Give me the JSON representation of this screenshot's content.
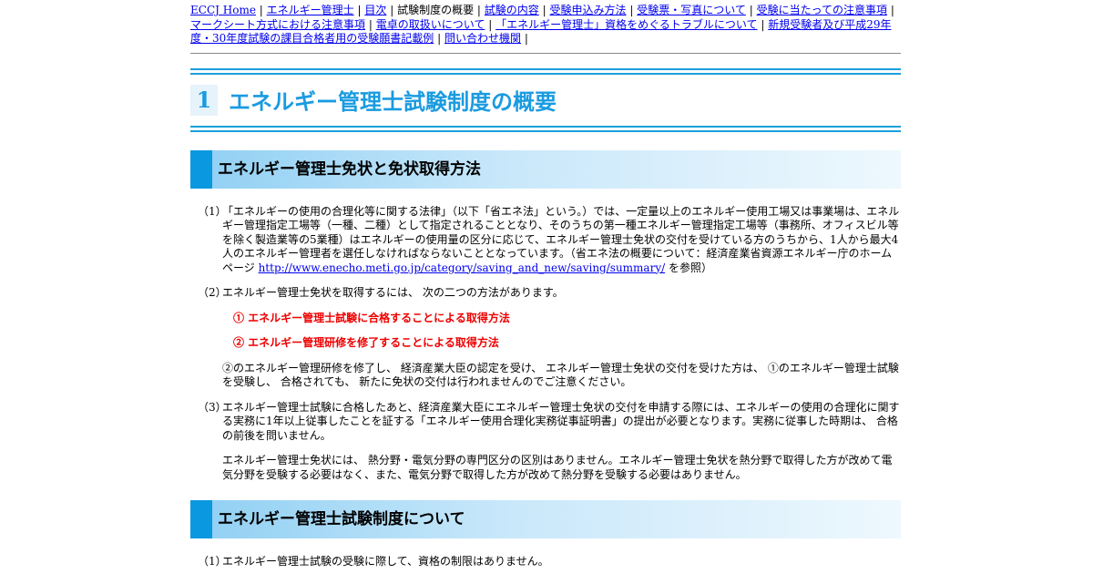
{
  "nav": {
    "items": [
      {
        "label": "ECCJ Home",
        "link": true
      },
      {
        "label": "エネルギー管理士",
        "link": true
      },
      {
        "label": "目次",
        "link": true
      },
      {
        "label": "試験制度の概要",
        "link": false
      },
      {
        "label": "試験の内容",
        "link": true
      },
      {
        "label": "受験申込み方法",
        "link": true
      },
      {
        "label": "受験票・写真について",
        "link": true
      },
      {
        "label": "受験に当たっての注意事項",
        "link": true
      },
      {
        "label": "マークシート方式における注意事項",
        "link": true
      },
      {
        "label": "電卓の取扱いについて",
        "link": true
      },
      {
        "label": "「エネルギー管理士」資格をめぐるトラブルについて",
        "link": true
      },
      {
        "label": "新規受験者及び平成29年度・30年度試験の課目合格者用の受験願書記載例",
        "link": true
      },
      {
        "label": "問い合わせ機関",
        "link": true
      }
    ],
    "separator": "|"
  },
  "main": {
    "section_number": "1",
    "title": "エネルギー管理士試験制度の概要",
    "sections": [
      {
        "heading": "エネルギー管理士免状と免状取得方法",
        "p1_num": "（1）",
        "p1_text": "「エネルギーの使用の合理化等に関する法律」（以下「省エネ法」という。）では、一定量以上のエネルギー使用工場又は事業場は、エネルギー管理指定工場等（一種、二種）として指定されることとなり、そのうちの第一種エネルギー管理指定工場等（事務所、オフィスビル等を除く製造業等の5業種）はエネルギーの使用量の区分に応じて、エネルギー管理士免状の交付を受けている方のうちから、1人から最大4人のエネルギー管理者を選任しなければならないこととなっています。（省エネ法の概要について：経済産業省資源エネルギー庁のホームページ ",
        "p1_link": "http://www.enecho.meti.go.jp/category/saving_and_new/saving/summary/",
        "p1_after": " を参照）",
        "p2_num": "（2）",
        "p2_text": "エネルギー管理士免状を取得するには、 次の二つの方法があります。",
        "method1": "① エネルギー管理士試験に合格することによる取得方法",
        "method2": "② エネルギー管理研修を修了することによる取得方法",
        "note": "②のエネルギー管理研修を修了し、 経済産業大臣の認定を受け、 エネルギー管理士免状の交付を受けた方は、 ①のエネルギー管理士試験を受験し、 合格されても、 新たに免状の交付は行われませんのでご注意ください。",
        "p3_num": "（3）",
        "p3_text": "エネルギー管理士試験に合格したあと、経済産業大臣にエネルギー管理士免状の交付を申請する際には、エネルギーの使用の合理化に関する実務に1年以上従事したことを証する「エネルギー使用合理化実務従事証明書」の提出が必要となります。実務に従事した時期は、 合格の前後を問いません。",
        "p3_sub": "エネルギー管理士免状には、 熱分野・電気分野の専門区分の区別はありません。エネルギー管理士免状を熱分野で取得した方が改めて電気分野を受験する必要はなく、また、電気分野で取得した方が改めて熱分野を受験する必要はありません。"
      },
      {
        "heading": "エネルギー管理士試験制度について",
        "p1_num": "（1）",
        "p1_text": "エネルギー管理士試験の受験に際して、資格の制限はありません。"
      }
    ]
  },
  "colors": {
    "accent": "#1a9be0",
    "bar": "#0a98e0",
    "link": "#0000ee",
    "emphasis": "#ee0000"
  }
}
